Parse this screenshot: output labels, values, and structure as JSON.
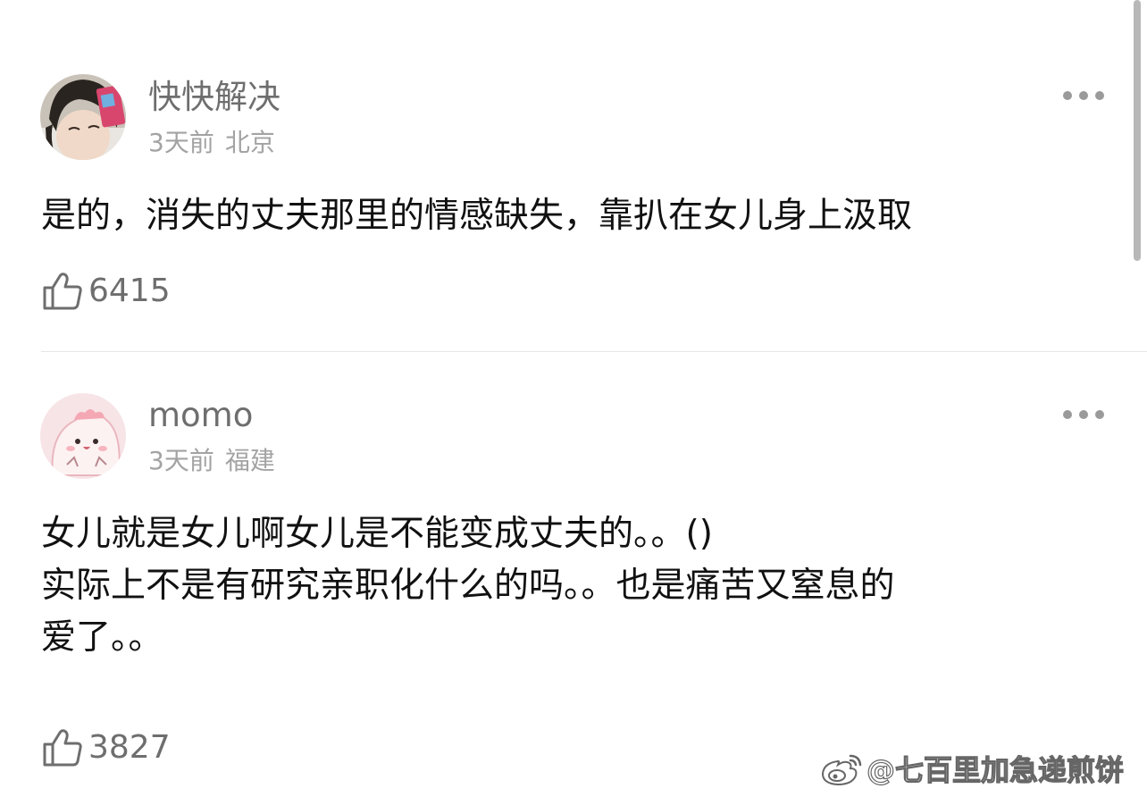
{
  "comments": [
    {
      "username": "快快解决",
      "time": "3天前",
      "location": "北京",
      "text": "是的，消失的丈夫那里的情感缺失，靠扒在女儿身上汲取",
      "likes": "6415",
      "avatar_icon": "photo-avatar-icon"
    },
    {
      "username": "momo",
      "time": "3天前",
      "location": "福建",
      "text": "女儿就是女儿啊女儿是不能变成丈夫的。。()\n实际上不是有研究亲职化什么的吗。。也是痛苦又窒息的\n爱了。。",
      "likes": "3827",
      "avatar_icon": "cartoon-avatar-icon"
    }
  ],
  "watermark": {
    "text": "@七百里加急递煎饼",
    "icon": "weibo-logo-icon"
  },
  "colors": {
    "username": "#6e6e6e",
    "meta": "#a3a3a3",
    "body_text": "#111111",
    "divider": "#e6e6e6"
  }
}
